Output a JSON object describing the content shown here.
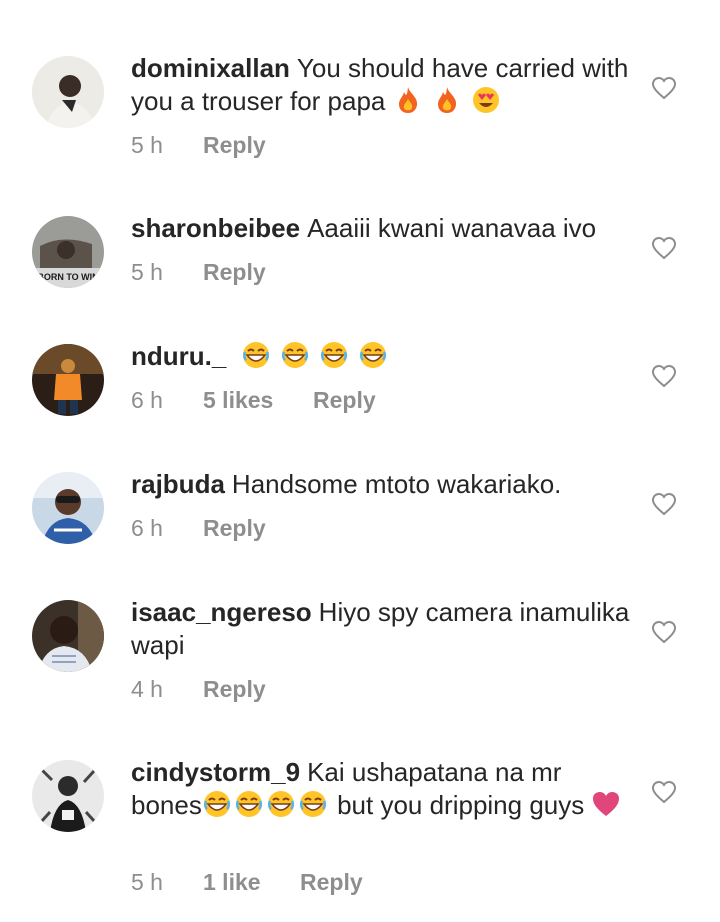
{
  "comments": [
    {
      "username": "dominixallan",
      "text": "You should have carried with you a trouser for papa",
      "emojis": [
        "fire",
        "fire",
        "heart-eyes"
      ],
      "tail": "",
      "time": "5 h",
      "likes": "",
      "reply": "Reply",
      "avatar_caption": ""
    },
    {
      "username": "sharonbeibee",
      "text": "Aaaiii kwani wanavaa ivo",
      "emojis": [],
      "tail": "",
      "time": "5 h",
      "likes": "",
      "reply": "Reply",
      "avatar_caption": "BORN TO WIN"
    },
    {
      "username": "nduru._",
      "text": "",
      "emojis": [
        "grin-laugh",
        "grin-laugh",
        "grin-laugh",
        "grin-laugh"
      ],
      "tail": "",
      "time": "6 h",
      "likes": "5 likes",
      "reply": "Reply",
      "avatar_caption": ""
    },
    {
      "username": "rajbuda",
      "text": "Handsome mtoto wakariako.",
      "emojis": [],
      "tail": "",
      "time": "6 h",
      "likes": "",
      "reply": "Reply",
      "avatar_caption": ""
    },
    {
      "username": "isaac_ngereso",
      "text": "Hiyo spy camera inamulika wapi",
      "emojis": [],
      "tail": "",
      "time": "4 h",
      "likes": "",
      "reply": "Reply",
      "avatar_caption": ""
    },
    {
      "username": "cindystorm_9",
      "text": "Kai ushapatana na mr bones",
      "emojis": [
        "grin-laugh",
        "grin-laugh",
        "grin-laugh",
        "grin-laugh"
      ],
      "tail": "but you dripping guys",
      "tail_emoji": "pink-heart",
      "time": "5 h",
      "likes": "1 like",
      "reply": "Reply",
      "avatar_caption": ""
    }
  ],
  "icons": {
    "like": "heart-outline-icon"
  },
  "colors": {
    "text": "#262626",
    "meta": "#8e8e8e",
    "heart_emoji": "#e0457b"
  }
}
